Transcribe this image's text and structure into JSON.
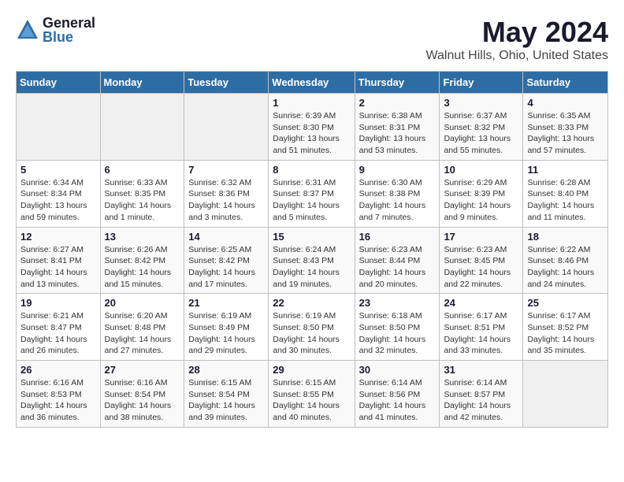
{
  "header": {
    "logo_general": "General",
    "logo_blue": "Blue",
    "month": "May 2024",
    "location": "Walnut Hills, Ohio, United States"
  },
  "days_of_week": [
    "Sunday",
    "Monday",
    "Tuesday",
    "Wednesday",
    "Thursday",
    "Friday",
    "Saturday"
  ],
  "weeks": [
    [
      {
        "day": "",
        "info": ""
      },
      {
        "day": "",
        "info": ""
      },
      {
        "day": "",
        "info": ""
      },
      {
        "day": "1",
        "info": "Sunrise: 6:39 AM\nSunset: 8:30 PM\nDaylight: 13 hours\nand 51 minutes."
      },
      {
        "day": "2",
        "info": "Sunrise: 6:38 AM\nSunset: 8:31 PM\nDaylight: 13 hours\nand 53 minutes."
      },
      {
        "day": "3",
        "info": "Sunrise: 6:37 AM\nSunset: 8:32 PM\nDaylight: 13 hours\nand 55 minutes."
      },
      {
        "day": "4",
        "info": "Sunrise: 6:35 AM\nSunset: 8:33 PM\nDaylight: 13 hours\nand 57 minutes."
      }
    ],
    [
      {
        "day": "5",
        "info": "Sunrise: 6:34 AM\nSunset: 8:34 PM\nDaylight: 13 hours\nand 59 minutes."
      },
      {
        "day": "6",
        "info": "Sunrise: 6:33 AM\nSunset: 8:35 PM\nDaylight: 14 hours\nand 1 minute."
      },
      {
        "day": "7",
        "info": "Sunrise: 6:32 AM\nSunset: 8:36 PM\nDaylight: 14 hours\nand 3 minutes."
      },
      {
        "day": "8",
        "info": "Sunrise: 6:31 AM\nSunset: 8:37 PM\nDaylight: 14 hours\nand 5 minutes."
      },
      {
        "day": "9",
        "info": "Sunrise: 6:30 AM\nSunset: 8:38 PM\nDaylight: 14 hours\nand 7 minutes."
      },
      {
        "day": "10",
        "info": "Sunrise: 6:29 AM\nSunset: 8:39 PM\nDaylight: 14 hours\nand 9 minutes."
      },
      {
        "day": "11",
        "info": "Sunrise: 6:28 AM\nSunset: 8:40 PM\nDaylight: 14 hours\nand 11 minutes."
      }
    ],
    [
      {
        "day": "12",
        "info": "Sunrise: 6:27 AM\nSunset: 8:41 PM\nDaylight: 14 hours\nand 13 minutes."
      },
      {
        "day": "13",
        "info": "Sunrise: 6:26 AM\nSunset: 8:42 PM\nDaylight: 14 hours\nand 15 minutes."
      },
      {
        "day": "14",
        "info": "Sunrise: 6:25 AM\nSunset: 8:42 PM\nDaylight: 14 hours\nand 17 minutes."
      },
      {
        "day": "15",
        "info": "Sunrise: 6:24 AM\nSunset: 8:43 PM\nDaylight: 14 hours\nand 19 minutes."
      },
      {
        "day": "16",
        "info": "Sunrise: 6:23 AM\nSunset: 8:44 PM\nDaylight: 14 hours\nand 20 minutes."
      },
      {
        "day": "17",
        "info": "Sunrise: 6:23 AM\nSunset: 8:45 PM\nDaylight: 14 hours\nand 22 minutes."
      },
      {
        "day": "18",
        "info": "Sunrise: 6:22 AM\nSunset: 8:46 PM\nDaylight: 14 hours\nand 24 minutes."
      }
    ],
    [
      {
        "day": "19",
        "info": "Sunrise: 6:21 AM\nSunset: 8:47 PM\nDaylight: 14 hours\nand 26 minutes."
      },
      {
        "day": "20",
        "info": "Sunrise: 6:20 AM\nSunset: 8:48 PM\nDaylight: 14 hours\nand 27 minutes."
      },
      {
        "day": "21",
        "info": "Sunrise: 6:19 AM\nSunset: 8:49 PM\nDaylight: 14 hours\nand 29 minutes."
      },
      {
        "day": "22",
        "info": "Sunrise: 6:19 AM\nSunset: 8:50 PM\nDaylight: 14 hours\nand 30 minutes."
      },
      {
        "day": "23",
        "info": "Sunrise: 6:18 AM\nSunset: 8:50 PM\nDaylight: 14 hours\nand 32 minutes."
      },
      {
        "day": "24",
        "info": "Sunrise: 6:17 AM\nSunset: 8:51 PM\nDaylight: 14 hours\nand 33 minutes."
      },
      {
        "day": "25",
        "info": "Sunrise: 6:17 AM\nSunset: 8:52 PM\nDaylight: 14 hours\nand 35 minutes."
      }
    ],
    [
      {
        "day": "26",
        "info": "Sunrise: 6:16 AM\nSunset: 8:53 PM\nDaylight: 14 hours\nand 36 minutes."
      },
      {
        "day": "27",
        "info": "Sunrise: 6:16 AM\nSunset: 8:54 PM\nDaylight: 14 hours\nand 38 minutes."
      },
      {
        "day": "28",
        "info": "Sunrise: 6:15 AM\nSunset: 8:54 PM\nDaylight: 14 hours\nand 39 minutes."
      },
      {
        "day": "29",
        "info": "Sunrise: 6:15 AM\nSunset: 8:55 PM\nDaylight: 14 hours\nand 40 minutes."
      },
      {
        "day": "30",
        "info": "Sunrise: 6:14 AM\nSunset: 8:56 PM\nDaylight: 14 hours\nand 41 minutes."
      },
      {
        "day": "31",
        "info": "Sunrise: 6:14 AM\nSunset: 8:57 PM\nDaylight: 14 hours\nand 42 minutes."
      },
      {
        "day": "",
        "info": ""
      }
    ]
  ]
}
